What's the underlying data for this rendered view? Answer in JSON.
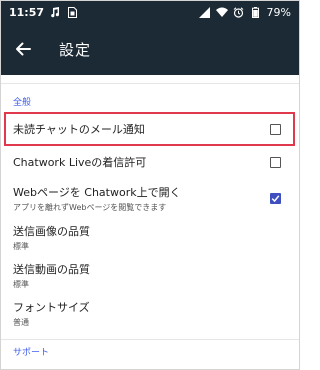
{
  "status_bar": {
    "time": "11:57",
    "left_icons": [
      "music-note-icon",
      "sim-card-icon"
    ],
    "right_icons": [
      "signal-icon",
      "wifi-icon",
      "alarm-icon"
    ],
    "battery": "79%"
  },
  "app_bar": {
    "title": "設定",
    "back_icon": "arrow-left-icon"
  },
  "sections": [
    {
      "header": "全般",
      "items": [
        {
          "title": "未読チャットのメール通知",
          "subtitle": "",
          "checkbox": true,
          "checked": false,
          "highlighted": true
        },
        {
          "title": "Chatwork Liveの着信許可",
          "subtitle": "",
          "checkbox": true,
          "checked": false,
          "highlighted": false
        },
        {
          "title": "Webページを Chatwork上で開く",
          "subtitle": "アプリを離れずWebページを閲覧できます",
          "checkbox": true,
          "checked": true,
          "highlighted": false
        },
        {
          "title": "送信画像の品質",
          "subtitle": "標準",
          "checkbox": false,
          "checked": false,
          "highlighted": false
        },
        {
          "title": "送信動画の品質",
          "subtitle": "標準",
          "checkbox": false,
          "checked": false,
          "highlighted": false
        },
        {
          "title": "フォントサイズ",
          "subtitle": "普通",
          "checkbox": false,
          "checked": false,
          "highlighted": false
        }
      ]
    },
    {
      "header": "サポート",
      "items": []
    }
  ],
  "colors": {
    "bar_background": "#1b2a35",
    "section_header": "#3f5df0",
    "checkbox_checked": "#3f4fbf",
    "highlight_border": "#e0384c"
  }
}
